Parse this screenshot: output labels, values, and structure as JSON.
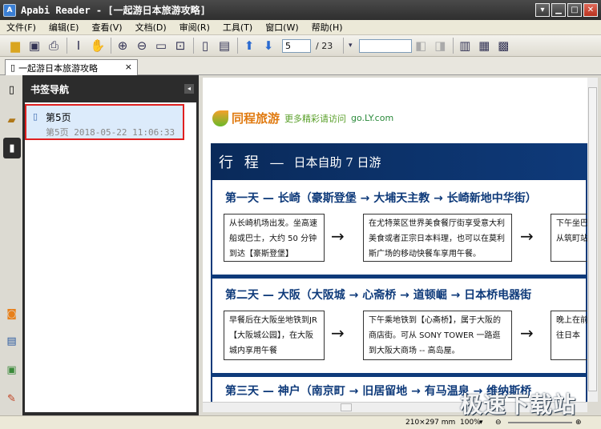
{
  "window": {
    "title": "Apabi Reader - [一起游日本旅游攻略]",
    "app_icon": "A"
  },
  "menu": [
    "文件(F)",
    "编辑(E)",
    "查看(V)",
    "文档(D)",
    "审阅(R)",
    "工具(T)",
    "窗口(W)",
    "帮助(H)"
  ],
  "toolbar": {
    "page_current": "5",
    "page_total": "/ 23"
  },
  "tab": {
    "label": "一起游日本旅游攻略",
    "close": "×"
  },
  "bookmark_panel": {
    "title": "书签导航",
    "items": [
      {
        "label": "第5页",
        "detail": "第5页  2018-05-22 11:06:33"
      }
    ]
  },
  "document": {
    "brand": "同程旅游",
    "tagline": "更多精彩请访问",
    "url": "go.LY.com",
    "band_big": "行 程 —",
    "band_small": "日本自助 7 日游",
    "days": [
      {
        "title": "第一天 — 长崎（豪斯登堡 → 大埔天主教 → 长崎新地中华街）",
        "box1": "从长崎机场出发。坐高速船或巴士，大约 50 分钟到达【豪斯登堡】",
        "box2": "在尤特莱区世界美食餐厅街享受意大利美食或者正宗日本料理，也可以在莫利斯广场的移动快餐车享用午餐。",
        "box3": "下午坐巴从筑町站"
      },
      {
        "title": "第二天 — 大阪（大阪城 → 心斋桥 → 道顿崛 → 日本桥电器街",
        "box1": "早餐后在大阪坐地铁到JR【大阪城公园】，在大阪城内享用午餐",
        "box2": "下午乘地铁到【心斋桥】，属于大阪的商店街。可从 SONY TOWER 一路逛到大阪大商场 -- 高岛屋。",
        "box3": "晚上在前往日本"
      },
      {
        "title": "第三天 — 神户（南京町 → 旧居留地 → 有马温泉 → 维纳斯桥"
      }
    ],
    "arrow": "→"
  },
  "status": {
    "paper": "210×297 mm",
    "zoom": "100%"
  },
  "watermark": "极速下载站"
}
